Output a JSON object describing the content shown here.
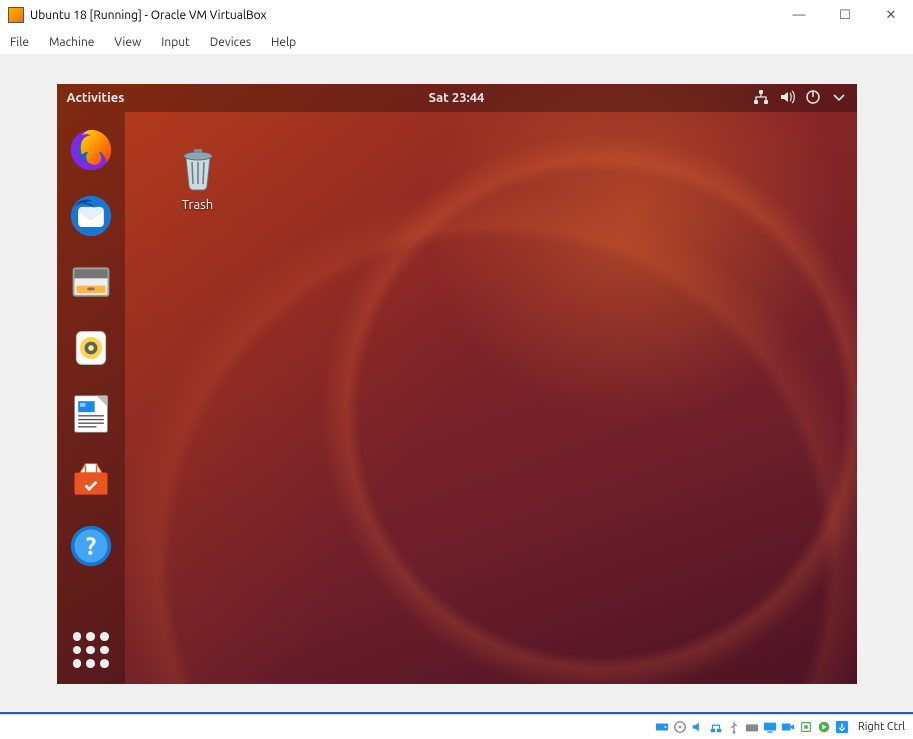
{
  "window": {
    "title": "Ubuntu 18 [Running] - Oracle VM VirtualBox"
  },
  "menubar": {
    "items": [
      "File",
      "Machine",
      "View",
      "Input",
      "Devices",
      "Help"
    ]
  },
  "guest": {
    "topbar": {
      "activities": "Activities",
      "clock": "Sat 23:44"
    },
    "desktop": {
      "trash_label": "Trash"
    },
    "dock": {
      "apps": [
        {
          "name": "firefox"
        },
        {
          "name": "thunderbird"
        },
        {
          "name": "files"
        },
        {
          "name": "rhythmbox"
        },
        {
          "name": "libreoffice-writer"
        },
        {
          "name": "ubuntu-software"
        },
        {
          "name": "help"
        }
      ]
    }
  },
  "statusbar": {
    "host_key": "Right Ctrl"
  }
}
